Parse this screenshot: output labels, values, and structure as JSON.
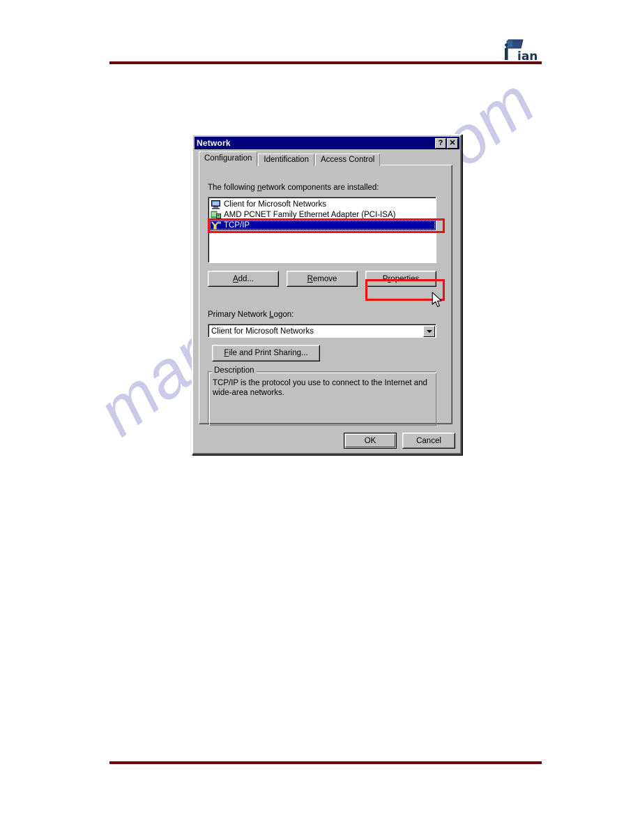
{
  "page": {
    "brand_logo_text": "iTian",
    "watermark_text": "manualshive.com",
    "rule_color": "#6b0712"
  },
  "dialog": {
    "title": "Network",
    "titlebar_buttons": [
      {
        "name": "help-button",
        "glyph": "?"
      },
      {
        "name": "close-button",
        "glyph": "✕"
      }
    ],
    "tabs": [
      {
        "label": "Configuration",
        "active": true
      },
      {
        "label": "Identification",
        "active": false
      },
      {
        "label": "Access Control",
        "active": false
      }
    ],
    "list_label_pre": "The following ",
    "list_label_key": "n",
    "list_label_post": "etwork components are installed:",
    "components": [
      {
        "label": "Client for Microsoft Networks",
        "icon": "client-computer-icon",
        "selected": false
      },
      {
        "label": "AMD PCNET Family Ethernet Adapter (PCI-ISA)",
        "icon": "network-adapter-icon",
        "selected": false
      },
      {
        "label": "TCP/IP",
        "icon": "protocol-icon",
        "selected": true
      }
    ],
    "buttons": {
      "add": {
        "pre": "",
        "key": "A",
        "post": "dd..."
      },
      "remove": {
        "pre": "",
        "key": "R",
        "post": "emove"
      },
      "properties": {
        "pre": "P",
        "key": "r",
        "post": "operties"
      },
      "file_print_sharing": {
        "pre": "",
        "key": "F",
        "post": "ile and Print Sharing..."
      },
      "ok": {
        "label": "OK"
      },
      "cancel": {
        "label": "Cancel"
      }
    },
    "logon_label_pre": "Primary Network ",
    "logon_label_key": "L",
    "logon_label_post": "ogon:",
    "logon_value": "Client for Microsoft Networks",
    "description": {
      "title": "Description",
      "text": "TCP/IP is the protocol you use to connect to the Internet and wide-area networks."
    }
  },
  "annotations": {
    "highlight_color": "#ee1111",
    "highlighted_items": [
      "tcpip-list-row",
      "properties-button"
    ]
  }
}
